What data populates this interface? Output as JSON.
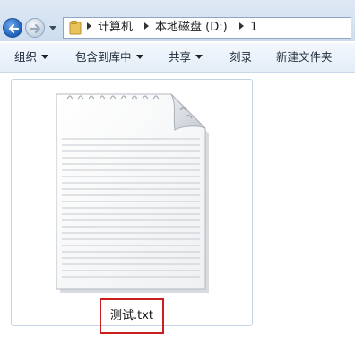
{
  "address_bar": {
    "breadcrumbs": [
      "计算机",
      "本地磁盘 (D:)",
      "1"
    ]
  },
  "toolbar": {
    "organize_label": "组织",
    "include_library_label": "包含到库中",
    "share_label": "共享",
    "burn_label": "刻录",
    "new_folder_label": "新建文件夹"
  },
  "content": {
    "file": {
      "name": "测试.txt",
      "icon": "text-document-icon"
    }
  },
  "colors": {
    "highlight_box": "#cc1e1e",
    "toolbar_bg": "#e8f0fa"
  }
}
